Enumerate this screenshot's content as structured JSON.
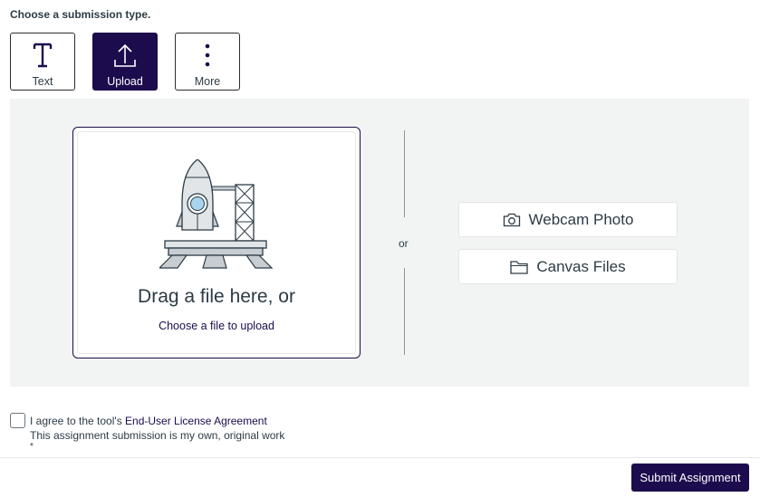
{
  "heading": "Choose a submission type.",
  "submission_types": [
    {
      "label": "Text",
      "icon": "text-icon",
      "selected": false
    },
    {
      "label": "Upload",
      "icon": "upload-icon",
      "selected": true
    },
    {
      "label": "More",
      "icon": "more-vertical-icon",
      "selected": false
    }
  ],
  "dropzone": {
    "title": "Drag a file here, or",
    "link": "Choose a file to upload",
    "illustration": "rocket-launch-illustration"
  },
  "separator": "or",
  "options": {
    "webcam": {
      "label": "Webcam Photo",
      "icon": "camera-icon"
    },
    "canvas_files": {
      "label": "Canvas Files",
      "icon": "folder-icon"
    }
  },
  "agreement": {
    "prefix": "I agree to the tool's ",
    "link": "End-User License Agreement",
    "statement": "This assignment submission is my own, original work",
    "required_marker": "*",
    "checked": false
  },
  "submit_label": "Submit Assignment",
  "colors": {
    "accent": "#1c0c4e",
    "panel_bg": "#f2f3f3",
    "text": "#2d3b45"
  }
}
